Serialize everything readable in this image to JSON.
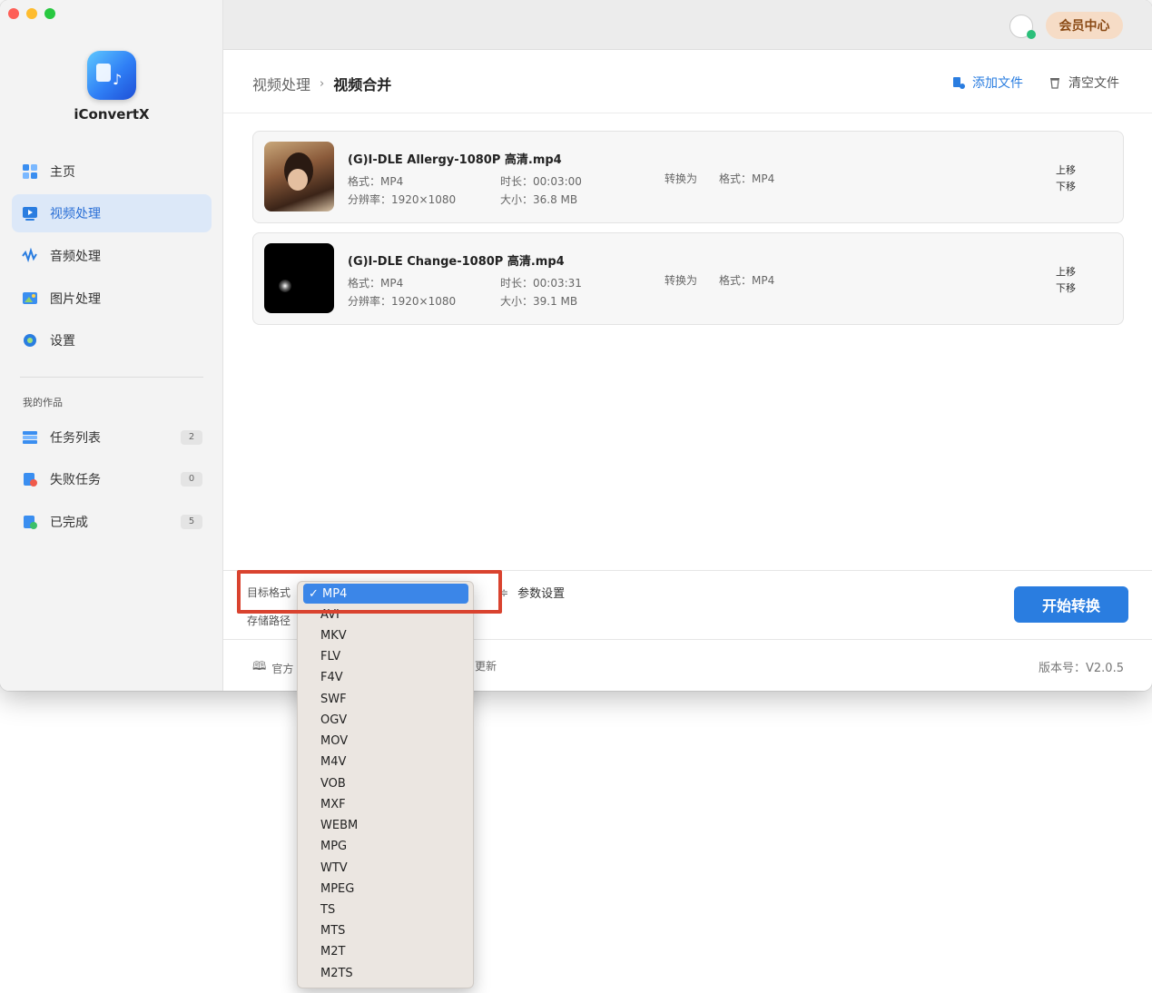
{
  "app": {
    "name": "iConvertX"
  },
  "sidebar": {
    "nav": [
      {
        "label": "主页",
        "icon": "home-icon"
      },
      {
        "label": "视频处理",
        "icon": "video-processing-icon",
        "active": true
      },
      {
        "label": "音频处理",
        "icon": "audio-wave-icon"
      },
      {
        "label": "图片处理",
        "icon": "image-icon"
      },
      {
        "label": "设置",
        "icon": "gear-icon"
      }
    ],
    "works_title": "我的作品",
    "works": [
      {
        "label": "任务列表",
        "count": "2",
        "icon": "task-list-icon"
      },
      {
        "label": "失败任务",
        "count": "0",
        "icon": "failed-task-icon"
      },
      {
        "label": "已完成",
        "count": "5",
        "icon": "completed-icon"
      }
    ]
  },
  "topbar": {
    "member_center": "会员中心"
  },
  "header": {
    "breadcrumb_parent": "视频处理",
    "breadcrumb_sep": "›",
    "breadcrumb_current": "视频合并",
    "add_files": "添加文件",
    "clear_files": "清空文件"
  },
  "files": [
    {
      "name": "(G)I-DLE Allergy-1080P 高清.mp4",
      "format": "格式：MP4",
      "duration": "时长：00:03:00",
      "resolution": "分辨率：1920×1080",
      "size": "大小：36.8 MB",
      "convert_to": "转换为",
      "target_format": "格式：MP4",
      "move_up": "上移",
      "move_down": "下移"
    },
    {
      "name": "(G)I-DLE Change-1080P 高清.mp4",
      "format": "格式：MP4",
      "duration": "时长：00:03:31",
      "resolution": "分辨率：1920×1080",
      "size": "大小：39.1 MB",
      "convert_to": "转换为",
      "target_format": "格式：MP4",
      "move_up": "上移",
      "move_down": "下移"
    }
  ],
  "bottom": {
    "target_format_label": "目标格式",
    "storage_path_label": "存储路径",
    "param_settings": "参数设置",
    "start_convert": "开始转换",
    "footer_left": "官方",
    "footer_mid": "更新",
    "version": "版本号：V2.0.5"
  },
  "dropdown": {
    "selected": "✓ MP4",
    "options": [
      "AVI",
      "MKV",
      "FLV",
      "F4V",
      "SWF",
      "OGV",
      "MOV",
      "M4V",
      "VOB",
      "MXF",
      "WEBM",
      "MPG",
      "WTV",
      "MPEG",
      "TS",
      "MTS",
      "M2T",
      "M2TS"
    ]
  },
  "colors": {
    "accent": "#2a7de0",
    "highlight": "#d9432f",
    "member_bg": "#f6dcc6"
  }
}
